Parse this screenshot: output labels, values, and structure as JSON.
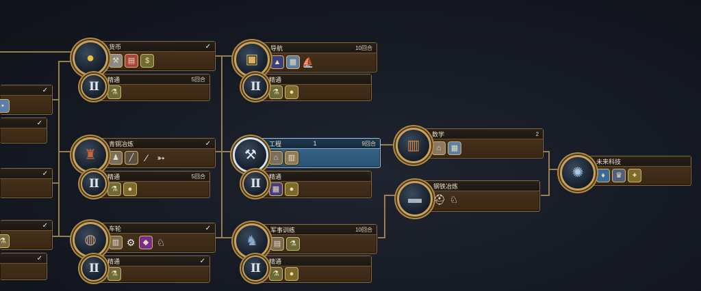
{
  "colors": {
    "line": "#b09058",
    "accent": "#c9a15a",
    "panel": "#3f2c17",
    "selected": "#356189"
  },
  "nodes": {
    "currency": {
      "name": "货币",
      "check": "✓",
      "icons": [
        "coin-icon",
        "worker-icon",
        "market-icon",
        "trade-icon"
      ]
    },
    "currency_mastery": {
      "name": "精通",
      "turns": "5回合",
      "roman": "II",
      "icons": [
        "flask-icon",
        "gold-icon"
      ]
    },
    "bronze": {
      "name": "青铜冶炼",
      "check": "✓",
      "icons": [
        "bronze-icon",
        "unit-icon",
        "spear-icon",
        "bow-icon"
      ]
    },
    "bronze_mastery": {
      "name": "精通",
      "turns": "5回合",
      "roman": "II",
      "icons": [
        "flask-icon",
        "gold-icon"
      ]
    },
    "wheel": {
      "name": "车轮",
      "check": "✓",
      "icons": [
        "wheel-icon",
        "lumber-icon",
        "catapult-icon",
        "chariot-icon",
        "horse-icon"
      ]
    },
    "wheel_mastery": {
      "name": "精通",
      "check": "✓",
      "roman": "II",
      "icons": [
        "flask-icon"
      ]
    },
    "navigation": {
      "name": "导航",
      "turns": "10回合",
      "icons": [
        "scroll-icon",
        "wonder-icon",
        "building-icon",
        "ship-icon"
      ]
    },
    "navigation_mastery": {
      "name": "精通",
      "roman": "II",
      "icons": [
        "flask-icon",
        "gold-icon"
      ]
    },
    "engineering": {
      "name": "工程",
      "num": "1",
      "turns": "9回合",
      "icons": [
        "tools-icon",
        "workshop-icon",
        "wall-icon"
      ]
    },
    "engineering_mastery": {
      "name": "精通",
      "roman": "II",
      "icons": [
        "building-icon",
        "gold-icon"
      ]
    },
    "military": {
      "name": "军事训练",
      "turns": "10回合",
      "icons": [
        "soldier-icon",
        "barracks-icon",
        "flask-icon"
      ]
    },
    "military_mastery": {
      "name": "精通",
      "roman": "II",
      "icons": [
        "flask-icon",
        "gold-icon"
      ]
    },
    "math": {
      "name": "数学",
      "num": "2",
      "icons": [
        "abacus-icon",
        "building-icon",
        "wonder-icon"
      ]
    },
    "iron": {
      "name": "钢铁冶炼",
      "icons": [
        "anvil-icon",
        "helmet-icon",
        "horse-icon"
      ]
    },
    "future": {
      "name": "未来科技",
      "icons": [
        "atom-icon",
        "science-icon",
        "culture-icon",
        "plus-icon"
      ]
    },
    "left_edge": [
      {
        "check": "✓"
      },
      {
        "check": "✓"
      },
      {
        "check": "✓"
      },
      {
        "check": "✓"
      },
      {
        "check": "✓"
      }
    ]
  }
}
